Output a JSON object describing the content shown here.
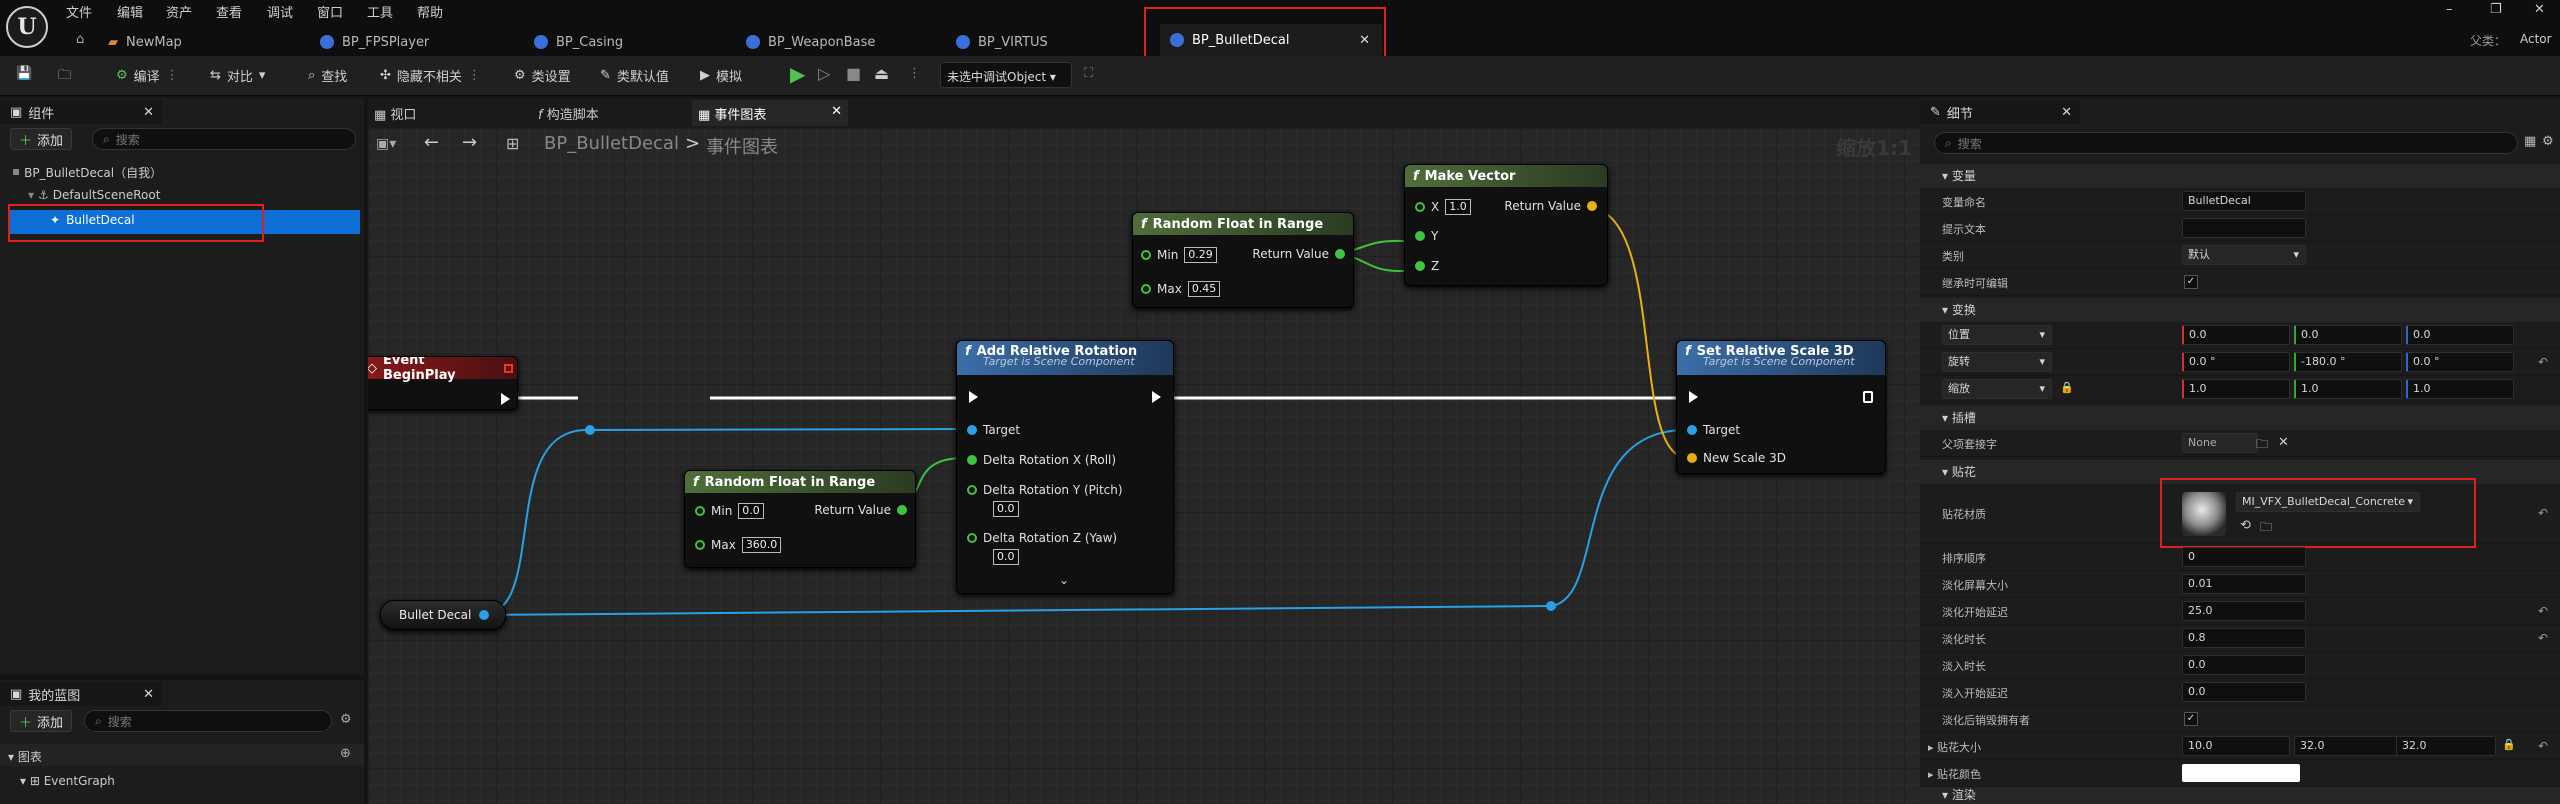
{
  "menu": [
    "文件",
    "编辑",
    "资产",
    "查看",
    "调试",
    "窗口",
    "工具",
    "帮助"
  ],
  "tabs": [
    "NewMap",
    "BP_FPSPlayer",
    "BP_Casing",
    "BP_WeaponBase",
    "BP_VIRTUS",
    "BP_BulletDecal"
  ],
  "parent_label": "父类：",
  "parent_value": "Actor",
  "toolbar": {
    "compile": "编译",
    "diff": "对比",
    "find": "查找",
    "hide": "隐藏不相关",
    "class_settings": "类设置",
    "class_defaults": "类默认值",
    "simulate": "模拟",
    "debug_object": "未选中调试Object"
  },
  "components": {
    "title": "组件",
    "add": "添加",
    "search": "搜索",
    "root": "BP_BulletDecal（自我）",
    "scene_root": "DefaultSceneRoot",
    "decal": "BulletDecal"
  },
  "mybp": {
    "title": "我的蓝图",
    "add": "添加",
    "search": "搜索",
    "graphs": "图表",
    "event_graph": "EventGraph"
  },
  "graph_tabs": [
    "视口",
    "构造脚本",
    "事件图表"
  ],
  "breadcrumb": {
    "bp": "BP_BulletDecal",
    "sep": ">",
    "graph": "事件图表",
    "zoom": "缩放1:1"
  },
  "nodes": {
    "begin": "Event BeginPlay",
    "rfr1": {
      "title": "Random Float in Range",
      "min_label": "Min",
      "min": "0.29",
      "max_label": "Max",
      "max": "0.45",
      "ret": "Return Value"
    },
    "mv": {
      "title": "Make Vector",
      "x_label": "X",
      "x": "1.0",
      "y": "Y",
      "z": "Z",
      "ret": "Return Value"
    },
    "arr": {
      "title": "Add Relative Rotation",
      "sub": "Target is Scene Component",
      "target": "Target",
      "dx": "Delta Rotation X (Roll)",
      "dy": "Delta Rotation Y (Pitch)",
      "dy_v": "0.0",
      "dz": "Delta Rotation Z (Yaw)",
      "dz_v": "0.0"
    },
    "rfr2": {
      "title": "Random Float in Range",
      "min_label": "Min",
      "min": "0.0",
      "max_label": "Max",
      "max": "360.0",
      "ret": "Return Value"
    },
    "srs": {
      "title": "Set Relative Scale 3D",
      "sub": "Target is Scene Component",
      "target": "Target",
      "scale": "New Scale 3D"
    },
    "var": "Bullet Decal"
  },
  "details": {
    "title": "细节",
    "search": "搜索",
    "sec_var": "变量",
    "var_name_l": "变量命名",
    "var_name": "BulletDecal",
    "tooltip_l": "提示文本",
    "category_l": "类别",
    "category": "默认",
    "editable_l": "继承时可编辑",
    "sec_transform": "变换",
    "loc": "位置",
    "rot": "旋转",
    "scale": "缩放",
    "loc_v": [
      "0.0",
      "0.0",
      "0.0"
    ],
    "rot_v": [
      "0.0 °",
      "-180.0 °",
      "0.0 °"
    ],
    "scale_v": [
      "1.0",
      "1.0",
      "1.0"
    ],
    "sec_socket": "插槽",
    "parent_socket_l": "父项套接字",
    "parent_socket": "None",
    "sec_decal": "贴花",
    "material_l": "贴花材质",
    "material": "MI_VFX_BulletDecal_Concrete",
    "sort_l": "排序顺序",
    "sort": "0",
    "fade_size_l": "淡化屏幕大小",
    "fade_size": "0.01",
    "fade_delay_l": "淡化开始延迟",
    "fade_delay": "25.0",
    "fade_dur_l": "淡化时长",
    "fade_dur": "0.8",
    "fadein_l": "淡入时长",
    "fadein": "0.0",
    "fadein_delay_l": "淡入开始延迟",
    "fadein_delay": "0.0",
    "destroy_l": "淡化后销毁拥有者",
    "decal_size_l": "贴花大小",
    "decal_size": [
      "10.0",
      "32.0",
      "32.0"
    ],
    "decal_color_l": "贴花颜色",
    "render_l": "渲染"
  }
}
